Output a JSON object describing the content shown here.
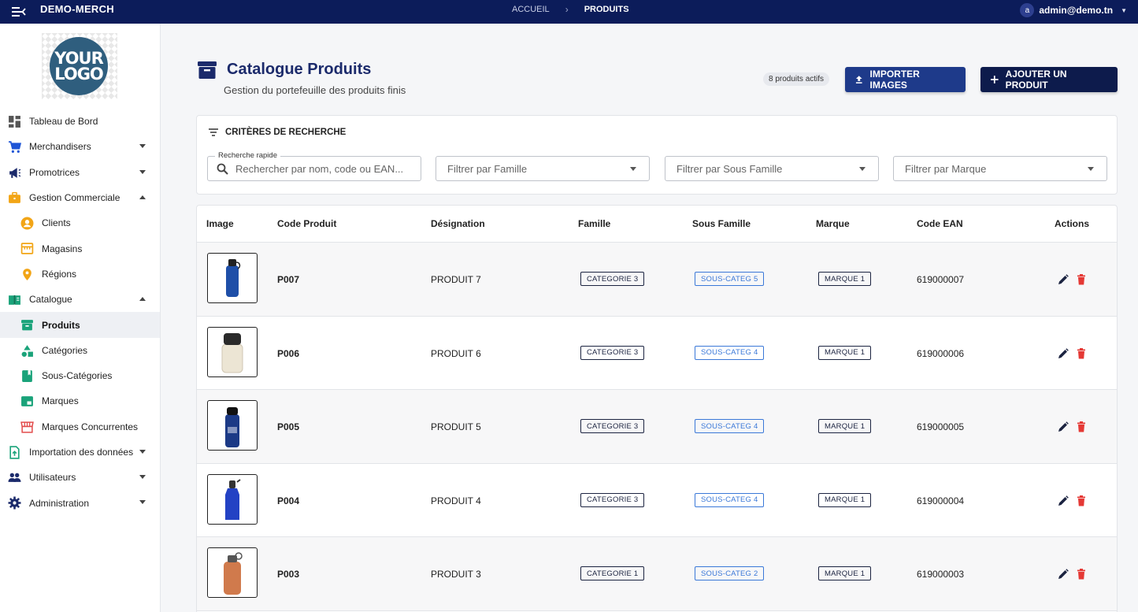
{
  "topbar": {
    "brand": "DEMO-MERCH",
    "breadcrumb_home": "ACCUEIL",
    "breadcrumb_current": "PRODUITS",
    "user_initial": "a",
    "user_email": "admin@demo.tn"
  },
  "logo": {
    "line1": "YOUR",
    "line2": "LOGO"
  },
  "sidebar": {
    "items": [
      {
        "label": "Tableau de Bord",
        "icon": "dashboard-icon",
        "color": "#444444"
      },
      {
        "label": "Merchandisers",
        "icon": "cart-icon",
        "color": "#1e55d6"
      },
      {
        "label": "Promotrices",
        "icon": "megaphone-icon",
        "color": "#1b2a6b"
      },
      {
        "label": "Gestion Commerciale",
        "icon": "briefcase-icon",
        "color": "#f2a516"
      },
      {
        "label": "Clients",
        "icon": "user-circle-icon",
        "color": "#f2a516"
      },
      {
        "label": "Magasins",
        "icon": "store-icon",
        "color": "#f2a516"
      },
      {
        "label": "Régions",
        "icon": "location-pin-icon",
        "color": "#f2a516"
      },
      {
        "label": "Catalogue",
        "icon": "book-icon",
        "color": "#1aa37a"
      },
      {
        "label": "Produits",
        "icon": "archive-box-icon",
        "color": "#1aa37a"
      },
      {
        "label": "Catégories",
        "icon": "shapes-icon",
        "color": "#1aa37a"
      },
      {
        "label": "Sous-Catégories",
        "icon": "bookmark-icon",
        "color": "#1aa37a"
      },
      {
        "label": "Marques",
        "icon": "label-icon",
        "color": "#1aa37a"
      },
      {
        "label": "Marques Concurrentes",
        "icon": "storefront-icon",
        "color": "#e24a4a"
      },
      {
        "label": "Importation des données",
        "icon": "file-upload-icon",
        "color": "#1aa37a"
      },
      {
        "label": "Utilisateurs",
        "icon": "people-icon",
        "color": "#1b2a6b"
      },
      {
        "label": "Administration",
        "icon": "gear-icon",
        "color": "#1b2a6b"
      }
    ]
  },
  "header": {
    "title": "Catalogue Produits",
    "subtitle": "Gestion du portefeuille des produits finis",
    "count_badge": "8 produits actifs",
    "import_label": "IMPORTER IMAGES",
    "add_label": "AJOUTER UN PRODUIT"
  },
  "filters": {
    "heading": "CRITÈRES DE RECHERCHE",
    "search_legend": "Recherche rapide",
    "search_placeholder": "Rechercher par nom, code ou EAN...",
    "famille": "Filtrer par Famille",
    "sous_famille": "Filtrer par Sous Famille",
    "marque": "Filtrer par Marque"
  },
  "table": {
    "columns": [
      "Image",
      "Code Produit",
      "Désignation",
      "Famille",
      "Sous Famille",
      "Marque",
      "Code EAN",
      "Actions"
    ],
    "rows": [
      {
        "code": "P007",
        "designation": "PRODUIT 7",
        "famille": "CATEGORIE 3",
        "sous_famille": "SOUS-CATEG 5",
        "marque": "MARQUE 1",
        "ean": "619000007",
        "bottle_color": "#1f4fa8"
      },
      {
        "code": "P006",
        "designation": "PRODUIT 6",
        "famille": "CATEGORIE 3",
        "sous_famille": "SOUS-CATEG 4",
        "marque": "MARQUE 1",
        "ean": "619000006",
        "bottle_color": "#ece5d4"
      },
      {
        "code": "P005",
        "designation": "PRODUIT 5",
        "famille": "CATEGORIE 3",
        "sous_famille": "SOUS-CATEG 4",
        "marque": "MARQUE 1",
        "ean": "619000005",
        "bottle_color": "#1c3a86"
      },
      {
        "code": "P004",
        "designation": "PRODUIT 4",
        "famille": "CATEGORIE 3",
        "sous_famille": "SOUS-CATEG 4",
        "marque": "MARQUE 1",
        "ean": "619000004",
        "bottle_color": "#2342c4"
      },
      {
        "code": "P003",
        "designation": "PRODUIT 3",
        "famille": "CATEGORIE 1",
        "sous_famille": "SOUS-CATEG 2",
        "marque": "MARQUE 1",
        "ean": "619000003",
        "bottle_color": "#d07a4c"
      }
    ]
  },
  "colors": {
    "topbar": "#0c1c5a",
    "primary": "#1e3a8a",
    "accent_dark": "#0d1b4c",
    "delete": "#e53935",
    "chip_blue": "#3a78d8"
  }
}
